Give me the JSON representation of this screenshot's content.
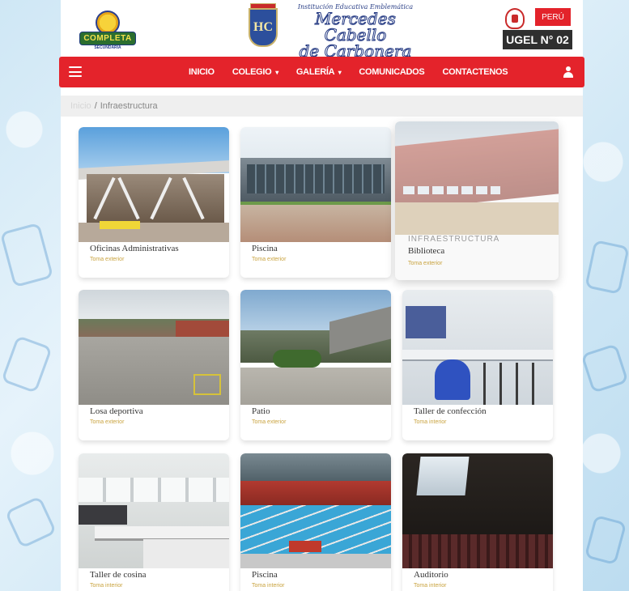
{
  "header": {
    "left_logo": {
      "badge_text": "COMPLETA",
      "sub_text": "SECUNDARIA"
    },
    "school": {
      "line1": "Institución Educativa Emblemática",
      "line2": "Mercedes Cabello",
      "line3": "de Carbonera"
    },
    "peru_label": "PERÚ",
    "ugel_label": "UGEL N° 02"
  },
  "nav": {
    "items": [
      {
        "label": "INICIO",
        "has_caret": false
      },
      {
        "label": "COLEGIO",
        "has_caret": true
      },
      {
        "label": "GALERÍA",
        "has_caret": true
      },
      {
        "label": "COMUNICADOS",
        "has_caret": false
      },
      {
        "label": "CONTACTENOS",
        "has_caret": false
      }
    ],
    "caret": "▾"
  },
  "breadcrumb": {
    "home": "Inicio",
    "separator": "/",
    "current": "Infraestructura"
  },
  "gallery": {
    "featured_label": "INFRAESTRUCTURA",
    "items": [
      {
        "title": "Oficinas Administrativas",
        "sub": "Toma exterior"
      },
      {
        "title": "Piscina",
        "sub": "Toma exterior"
      },
      {
        "title": "Biblioteca",
        "sub": "Toma exterior"
      },
      {
        "title": "Losa deportiva",
        "sub": "Toma exterior"
      },
      {
        "title": "Patio",
        "sub": "Toma exterior"
      },
      {
        "title": "Taller de confección",
        "sub": "Toma interior"
      },
      {
        "title": "Taller de cosina",
        "sub": "Toma interior"
      },
      {
        "title": "Piscina",
        "sub": "Toma interior"
      },
      {
        "title": "Auditorio",
        "sub": "Toma interior"
      }
    ]
  },
  "colors": {
    "nav_red": "#e4232b",
    "accent_gold": "#c9a33f",
    "ugel_dark": "#2f2f2f"
  }
}
